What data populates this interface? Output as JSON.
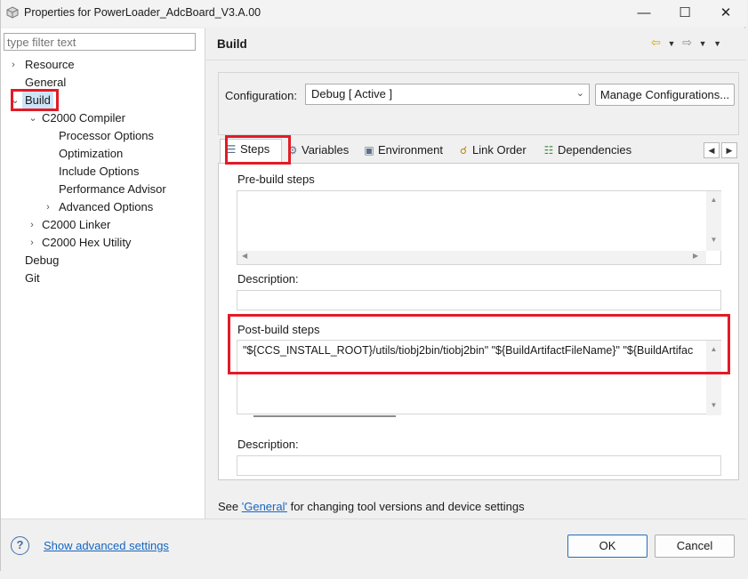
{
  "window": {
    "title": "Properties for PowerLoader_AdcBoard_V3.A.00",
    "minimize_glyph": "—",
    "maximize_glyph": "☐",
    "close_glyph": "✕"
  },
  "filter": {
    "placeholder": "type filter text"
  },
  "tree": {
    "resource": "Resource",
    "general": "General",
    "build": "Build",
    "c2000_compiler": "C2000 Compiler",
    "processor_options": "Processor Options",
    "optimization": "Optimization",
    "include_options": "Include Options",
    "performance_advisor": "Performance Advisor",
    "advanced_options": "Advanced Options",
    "c2000_linker": "C2000 Linker",
    "c2000_hex_utility": "C2000 Hex Utility",
    "debug": "Debug",
    "git": "Git"
  },
  "header": {
    "title": "Build"
  },
  "config": {
    "label": "Configuration:",
    "value": "Debug  [ Active ]",
    "manage_button": "Manage Configurations..."
  },
  "tabs": {
    "steps": "Steps",
    "variables": "Variables",
    "environment": "Environment",
    "link_order": "Link Order",
    "dependencies": "Dependencies"
  },
  "prebuild": {
    "title": "Pre-build steps",
    "command": "",
    "description_label": "Description:",
    "description": ""
  },
  "postbuild": {
    "title": "Post-build steps",
    "command": "\"${CCS_INSTALL_ROOT}/utils/tiobj2bin/tiobj2bin\" \"${BuildArtifactFileName}\" \"${BuildArtifac",
    "description_label": "Description:",
    "description": ""
  },
  "footer_note": {
    "prefix": "See ",
    "link": "'General'",
    "suffix": " for changing tool versions and device settings"
  },
  "bottom": {
    "advanced_link": "Show advanced settings",
    "ok": "OK",
    "cancel": "Cancel"
  },
  "icons": {
    "app": "gear-cube-icon",
    "help": "help-icon",
    "back": "back-arrow-icon",
    "forward": "forward-arrow-icon"
  },
  "colors": {
    "highlight_box": "#e21b26",
    "selection": "#cce4f7",
    "link": "#1565c0",
    "ok_border": "#1f6fbf"
  }
}
